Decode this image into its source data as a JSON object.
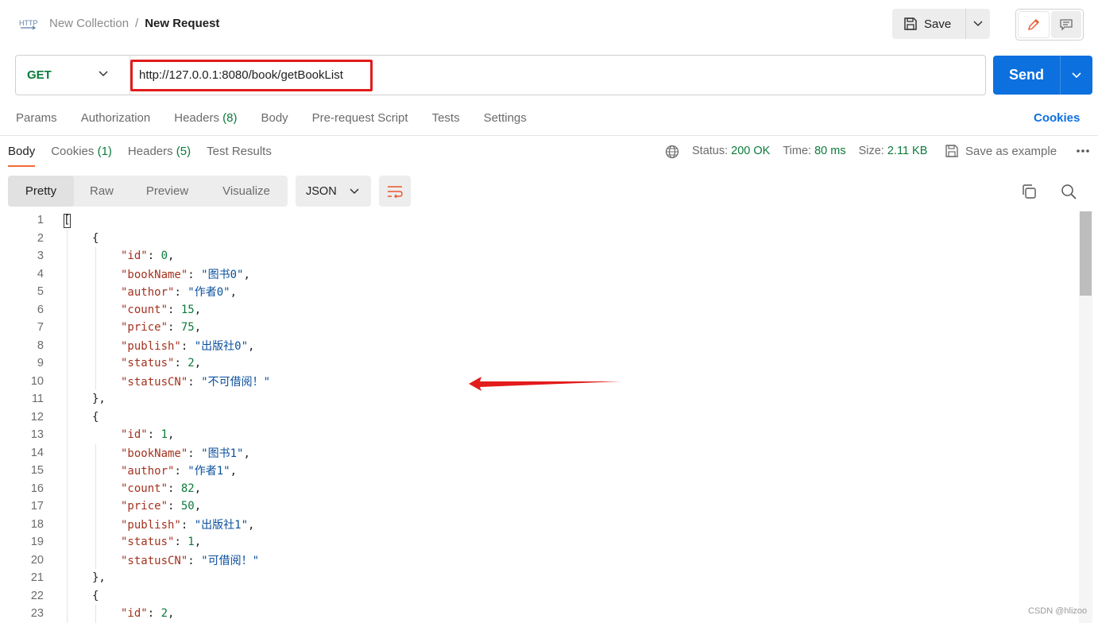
{
  "header": {
    "http_badge": "HTTP",
    "breadcrumb": {
      "collection": "New Collection",
      "separator": "/",
      "request": "New Request"
    },
    "save_label": "Save",
    "icons": {
      "http": "http-icon",
      "save": "floppy-disk-icon",
      "edit": "pencil-icon",
      "comment": "comment-icon"
    }
  },
  "request": {
    "method": "GET",
    "url": "http://127.0.0.1:8080/book/getBookList",
    "send_label": "Send",
    "tabs": [
      {
        "label": "Params",
        "count": ""
      },
      {
        "label": "Authorization",
        "count": ""
      },
      {
        "label": "Headers",
        "count": "(8)"
      },
      {
        "label": "Body",
        "count": ""
      },
      {
        "label": "Pre-request Script",
        "count": ""
      },
      {
        "label": "Tests",
        "count": ""
      },
      {
        "label": "Settings",
        "count": ""
      }
    ],
    "cookies_label": "Cookies"
  },
  "response": {
    "tabs": [
      {
        "label": "Body",
        "count": ""
      },
      {
        "label": "Cookies",
        "count": "(1)"
      },
      {
        "label": "Headers",
        "count": "(5)"
      },
      {
        "label": "Test Results",
        "count": ""
      }
    ],
    "status_label": "Status:",
    "status_value": "200 OK",
    "time_label": "Time:",
    "time_value": "80 ms",
    "size_label": "Size:",
    "size_value": "2.11 KB",
    "save_example_label": "Save as example",
    "view_modes": [
      "Pretty",
      "Raw",
      "Preview",
      "Visualize"
    ],
    "active_view": "Pretty",
    "format": "JSON"
  },
  "code_lines": [
    {
      "n": "1",
      "indent": 0,
      "parts": [
        [
          "p",
          "["
        ]
      ]
    },
    {
      "n": "2",
      "indent": 1,
      "parts": [
        [
          "p",
          "{"
        ]
      ]
    },
    {
      "n": "3",
      "indent": 2,
      "parts": [
        [
          "k",
          "\"id\""
        ],
        [
          "p",
          ": "
        ],
        [
          "n",
          "0"
        ],
        [
          "p",
          ","
        ]
      ]
    },
    {
      "n": "4",
      "indent": 2,
      "parts": [
        [
          "k",
          "\"bookName\""
        ],
        [
          "p",
          ": "
        ],
        [
          "s",
          "\"图书0\""
        ],
        [
          "p",
          ","
        ]
      ]
    },
    {
      "n": "5",
      "indent": 2,
      "parts": [
        [
          "k",
          "\"author\""
        ],
        [
          "p",
          ": "
        ],
        [
          "s",
          "\"作者0\""
        ],
        [
          "p",
          ","
        ]
      ]
    },
    {
      "n": "6",
      "indent": 2,
      "parts": [
        [
          "k",
          "\"count\""
        ],
        [
          "p",
          ": "
        ],
        [
          "n",
          "15"
        ],
        [
          "p",
          ","
        ]
      ]
    },
    {
      "n": "7",
      "indent": 2,
      "parts": [
        [
          "k",
          "\"price\""
        ],
        [
          "p",
          ": "
        ],
        [
          "n",
          "75"
        ],
        [
          "p",
          ","
        ]
      ]
    },
    {
      "n": "8",
      "indent": 2,
      "parts": [
        [
          "k",
          "\"publish\""
        ],
        [
          "p",
          ": "
        ],
        [
          "s",
          "\"出版社0\""
        ],
        [
          "p",
          ","
        ]
      ]
    },
    {
      "n": "9",
      "indent": 2,
      "parts": [
        [
          "k",
          "\"status\""
        ],
        [
          "p",
          ": "
        ],
        [
          "n",
          "2"
        ],
        [
          "p",
          ","
        ]
      ]
    },
    {
      "n": "10",
      "indent": 2,
      "parts": [
        [
          "k",
          "\"statusCN\""
        ],
        [
          "p",
          ": "
        ],
        [
          "s",
          "\"不可借阅！\""
        ]
      ]
    },
    {
      "n": "11",
      "indent": 1,
      "parts": [
        [
          "p",
          "},"
        ]
      ]
    },
    {
      "n": "12",
      "indent": 1,
      "parts": [
        [
          "p",
          "{"
        ]
      ]
    },
    {
      "n": "13",
      "indent": 2,
      "parts": [
        [
          "k",
          "\"id\""
        ],
        [
          "p",
          ": "
        ],
        [
          "n",
          "1"
        ],
        [
          "p",
          ","
        ]
      ]
    },
    {
      "n": "14",
      "indent": 2,
      "parts": [
        [
          "k",
          "\"bookName\""
        ],
        [
          "p",
          ": "
        ],
        [
          "s",
          "\"图书1\""
        ],
        [
          "p",
          ","
        ]
      ]
    },
    {
      "n": "15",
      "indent": 2,
      "parts": [
        [
          "k",
          "\"author\""
        ],
        [
          "p",
          ": "
        ],
        [
          "s",
          "\"作者1\""
        ],
        [
          "p",
          ","
        ]
      ]
    },
    {
      "n": "16",
      "indent": 2,
      "parts": [
        [
          "k",
          "\"count\""
        ],
        [
          "p",
          ": "
        ],
        [
          "n",
          "82"
        ],
        [
          "p",
          ","
        ]
      ]
    },
    {
      "n": "17",
      "indent": 2,
      "parts": [
        [
          "k",
          "\"price\""
        ],
        [
          "p",
          ": "
        ],
        [
          "n",
          "50"
        ],
        [
          "p",
          ","
        ]
      ]
    },
    {
      "n": "18",
      "indent": 2,
      "parts": [
        [
          "k",
          "\"publish\""
        ],
        [
          "p",
          ": "
        ],
        [
          "s",
          "\"出版社1\""
        ],
        [
          "p",
          ","
        ]
      ]
    },
    {
      "n": "19",
      "indent": 2,
      "parts": [
        [
          "k",
          "\"status\""
        ],
        [
          "p",
          ": "
        ],
        [
          "n",
          "1"
        ],
        [
          "p",
          ","
        ]
      ]
    },
    {
      "n": "20",
      "indent": 2,
      "parts": [
        [
          "k",
          "\"statusCN\""
        ],
        [
          "p",
          ": "
        ],
        [
          "s",
          "\"可借阅！\""
        ]
      ]
    },
    {
      "n": "21",
      "indent": 1,
      "parts": [
        [
          "p",
          "},"
        ]
      ]
    },
    {
      "n": "22",
      "indent": 1,
      "parts": [
        [
          "p",
          "{"
        ]
      ]
    },
    {
      "n": "23",
      "indent": 2,
      "parts": [
        [
          "k",
          "\"id\""
        ],
        [
          "p",
          ": "
        ],
        [
          "n",
          "2"
        ],
        [
          "p",
          ","
        ]
      ]
    }
  ],
  "colors": {
    "accent_blue": "#0c70de",
    "status_green": "#0b7a3a",
    "json_key": "#a3321f",
    "json_string": "#0a4f9c",
    "tab_underline": "#f26b3a",
    "annotation_red": "#e31b1b"
  },
  "watermark": "CSDN @hlizoo"
}
